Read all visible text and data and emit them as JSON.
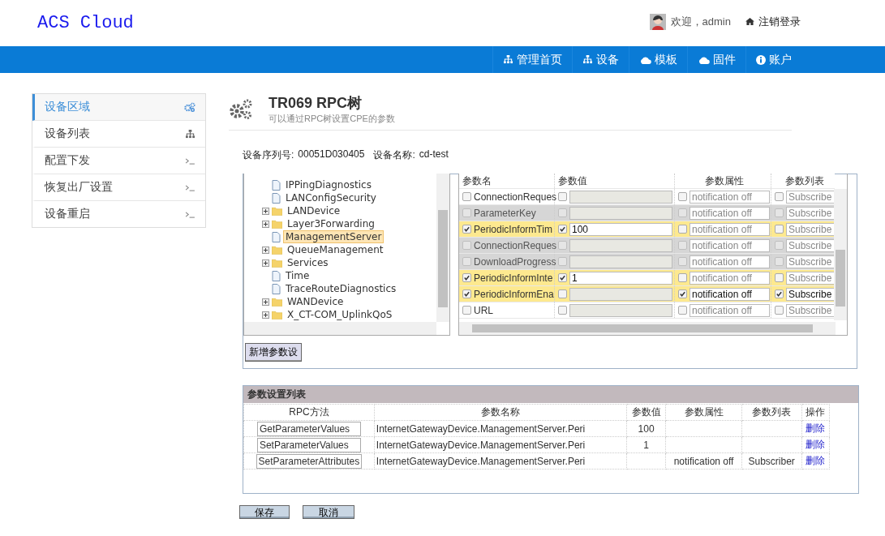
{
  "header": {
    "logo": "ACS Cloud",
    "welcome": "欢迎，admin",
    "logout": "注销登录"
  },
  "nav": [
    {
      "label": "管理首页",
      "kind": "sitemap"
    },
    {
      "label": "设备",
      "kind": "sitemap"
    },
    {
      "label": "模板",
      "kind": "cloud"
    },
    {
      "label": "固件",
      "kind": "cloud"
    },
    {
      "label": "账户",
      "kind": "info"
    }
  ],
  "sidebar": [
    {
      "label": "设备区域",
      "kind": "gears",
      "selected": true
    },
    {
      "label": "设备列表",
      "kind": "sitemap",
      "selected": false
    },
    {
      "label": "配置下发",
      "kind": "terminal",
      "selected": false
    },
    {
      "label": "恢复出厂设置",
      "kind": "terminal",
      "selected": false
    },
    {
      "label": "设备重启",
      "kind": "terminal",
      "selected": false
    }
  ],
  "page": {
    "title": "TR069 RPC树",
    "subtitle": "可以通过RPC树设置CPE的参数",
    "serial_label": "设备序列号:",
    "serial": "00051D030405",
    "name_label": "设备名称:",
    "name": "cd-test"
  },
  "tree": [
    {
      "label": "IPPingDiagnostics",
      "kind": "file",
      "selected": false
    },
    {
      "label": "LANConfigSecurity",
      "kind": "file",
      "selected": false
    },
    {
      "label": "LANDevice",
      "kind": "folder",
      "selected": false
    },
    {
      "label": "Layer3Forwarding",
      "kind": "folder",
      "selected": false
    },
    {
      "label": "ManagementServer",
      "kind": "file",
      "selected": true
    },
    {
      "label": "QueueManagement",
      "kind": "folder",
      "selected": false
    },
    {
      "label": "Services",
      "kind": "folder",
      "selected": false
    },
    {
      "label": "Time",
      "kind": "file",
      "selected": false
    },
    {
      "label": "TraceRouteDiagnostics",
      "kind": "file",
      "selected": false
    },
    {
      "label": "WANDevice",
      "kind": "folder",
      "selected": false
    },
    {
      "label": "X_CT-COM_UplinkQoS",
      "kind": "folder",
      "selected": false
    }
  ],
  "params": {
    "columns": [
      "参数名",
      "参数值",
      "参数属性",
      "参数列表"
    ],
    "rows": [
      {
        "name": "ConnectionReques",
        "selected": false,
        "disabled": false,
        "checked": false,
        "value_checked": false,
        "attr": "notification off",
        "attr_checked": false,
        "list": "Subscribe",
        "list_checked": false
      },
      {
        "name": "ParameterKey",
        "selected": false,
        "disabled": true,
        "checked": false,
        "value_checked": false,
        "attr": "notification off",
        "attr_checked": false,
        "list": "Subscribe",
        "list_checked": false
      },
      {
        "name": "PeriodicInformTim",
        "selected": true,
        "disabled": false,
        "checked": true,
        "value_checked": true,
        "value": "100",
        "attr": "notification off",
        "attr_checked": false,
        "list": "Subscribe",
        "list_checked": false
      },
      {
        "name": "ConnectionReques",
        "selected": false,
        "disabled": true,
        "checked": false,
        "value_checked": false,
        "attr": "notification off",
        "attr_checked": false,
        "list": "Subscribe",
        "list_checked": false
      },
      {
        "name": "DownloadProgress",
        "selected": false,
        "disabled": true,
        "checked": false,
        "value_checked": false,
        "attr": "notification off",
        "attr_checked": false,
        "list": "Subscribe",
        "list_checked": false
      },
      {
        "name": "PeriodicInformInte",
        "selected": true,
        "disabled": false,
        "checked": true,
        "value_checked": true,
        "value": "1",
        "attr": "notification off",
        "attr_checked": false,
        "list": "Subscribe",
        "list_checked": false
      },
      {
        "name": "PeriodicInformEna",
        "selected": true,
        "disabled": false,
        "checked": true,
        "value_checked": false,
        "attr": "notification off",
        "attr_checked": true,
        "list": "Subscribe",
        "list_checked": true
      },
      {
        "name": "URL",
        "selected": false,
        "disabled": false,
        "checked": false,
        "value_checked": false,
        "attr": "notification off",
        "attr_checked": false,
        "list": "Subscribe",
        "list_checked": false
      }
    ]
  },
  "add_button": "新增参数设",
  "settings": {
    "title": "参数设置列表",
    "columns": [
      "RPC方法",
      "参数名称",
      "参数值",
      "参数属性",
      "参数列表",
      "操作"
    ],
    "rows": [
      {
        "method": "GetParameterValues",
        "name": "InternetGatewayDevice.ManagementServer.Peri",
        "value": "100",
        "action": "删除"
      },
      {
        "method": "SetParameterValues",
        "name": "InternetGatewayDevice.ManagementServer.Peri",
        "value": "1",
        "action": "删除"
      },
      {
        "method": "SetParameterAttributes",
        "name": "InternetGatewayDevice.ManagementServer.Peri",
        "attr": "notification off",
        "list": "Subscriber",
        "action": "删除"
      }
    ]
  },
  "buttons": [
    "保存",
    "取消"
  ]
}
